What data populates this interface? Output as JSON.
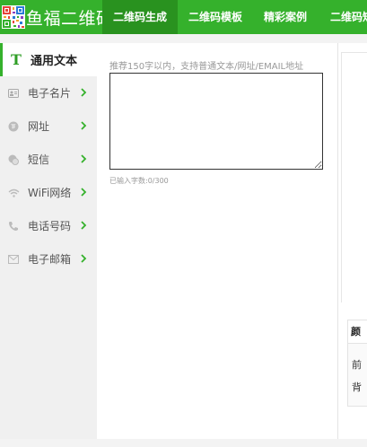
{
  "header": {
    "logo_text": "鱼福二维码",
    "nav": [
      {
        "label": "二维码生成",
        "active": true
      },
      {
        "label": "二维码模板",
        "active": false
      },
      {
        "label": "精彩案例",
        "active": false
      },
      {
        "label": "二维码短",
        "active": false
      }
    ],
    "accent": "#35b12c",
    "active_tab_color": "#29921f"
  },
  "sidebar": {
    "items": [
      {
        "label": "通用文本",
        "icon": "text-t-icon",
        "active": true
      },
      {
        "label": "电子名片",
        "icon": "id-card-icon"
      },
      {
        "label": "网址",
        "icon": "globe-icon"
      },
      {
        "label": "短信",
        "icon": "sms-bubble-icon"
      },
      {
        "label": "WiFi网络",
        "icon": "wifi-icon"
      },
      {
        "label": "电话号码",
        "icon": "phone-icon"
      },
      {
        "label": "电子邮箱",
        "icon": "mail-icon"
      }
    ]
  },
  "editor": {
    "hint": "推荐150字以内，支持普通文本/网址/EMAIL地址",
    "value": "",
    "char_count": "已输入字数:0/300"
  },
  "color_panel": {
    "tab": "颜",
    "foreground": "前",
    "background": "背"
  }
}
